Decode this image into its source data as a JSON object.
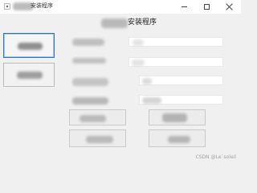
{
  "window": {
    "title": "安装程序",
    "minimize_icon": "minimize-icon",
    "maximize_icon": "maximize-icon",
    "close_icon": "close-icon"
  },
  "content": {
    "heading": "安装程序"
  },
  "watermark": {
    "text": "CSDN @Le`soleil"
  },
  "colors": {
    "window_bg": "#f0f0f0",
    "titlebar_bg": "#ffffff",
    "selected_border": "#2d73c6",
    "input_bg": "#ffffff"
  }
}
